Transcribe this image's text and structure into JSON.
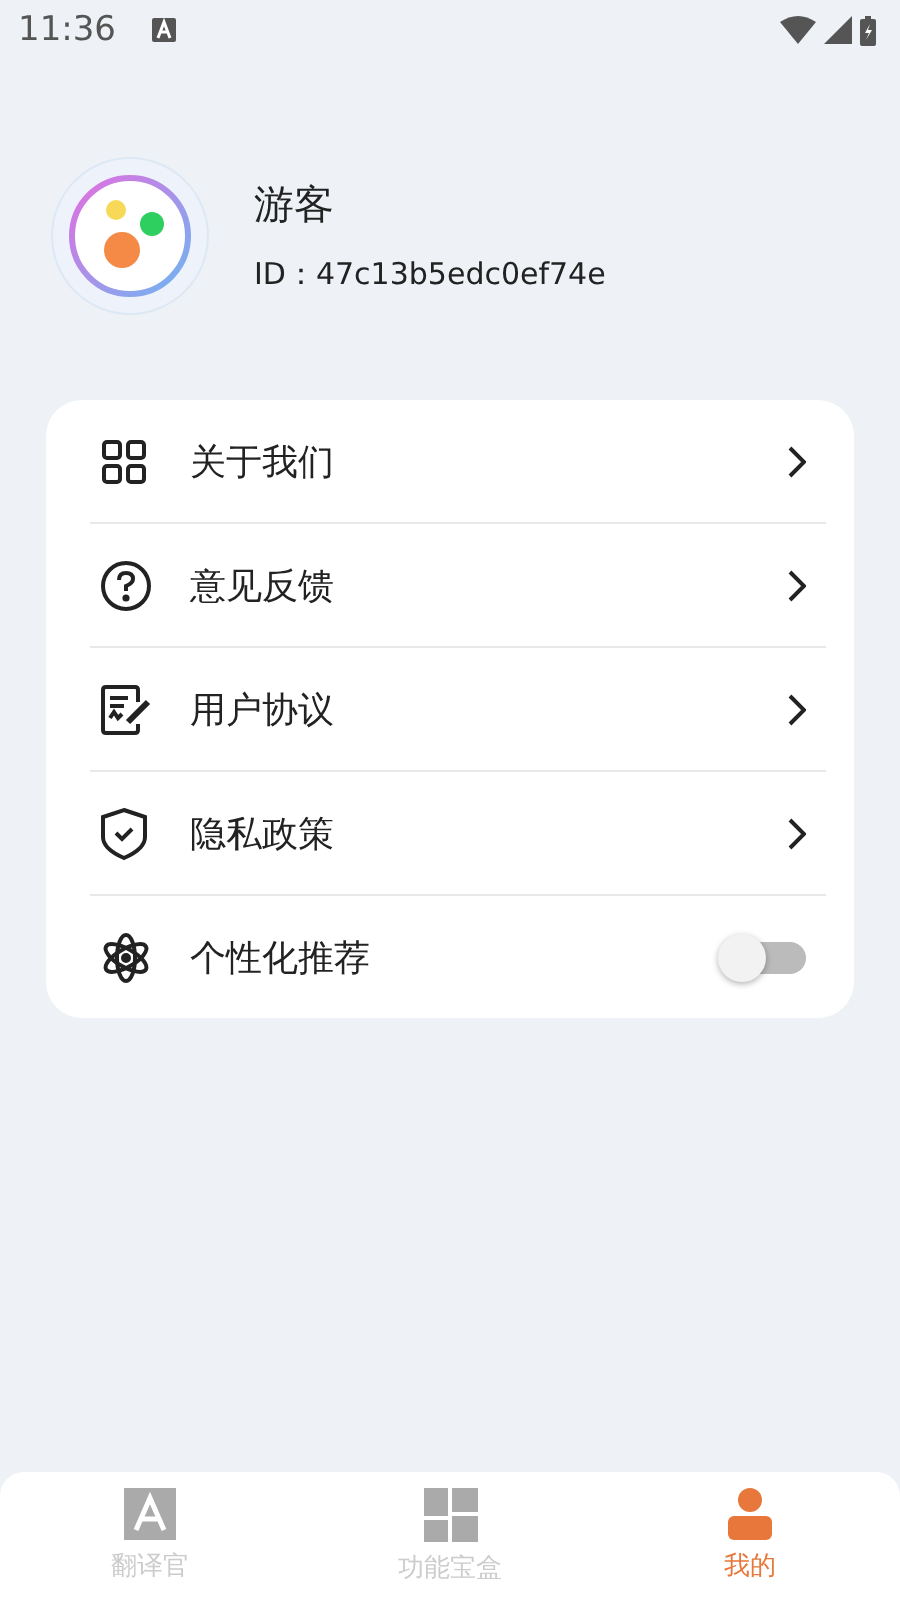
{
  "status_bar": {
    "time": "11:36"
  },
  "profile": {
    "name": "游客",
    "id": "ID：47c13b5edc0ef74e"
  },
  "menu": [
    {
      "kind": "link",
      "label": "关于我们"
    },
    {
      "kind": "link",
      "label": "意见反馈"
    },
    {
      "kind": "link",
      "label": "用户协议"
    },
    {
      "kind": "link",
      "label": "隐私政策"
    },
    {
      "kind": "toggle",
      "label": "个性化推荐",
      "on": false
    }
  ],
  "tabs": [
    {
      "label": "翻译官",
      "selected": false
    },
    {
      "label": "功能宝盒",
      "selected": false
    },
    {
      "label": "我的",
      "selected": true
    }
  ]
}
